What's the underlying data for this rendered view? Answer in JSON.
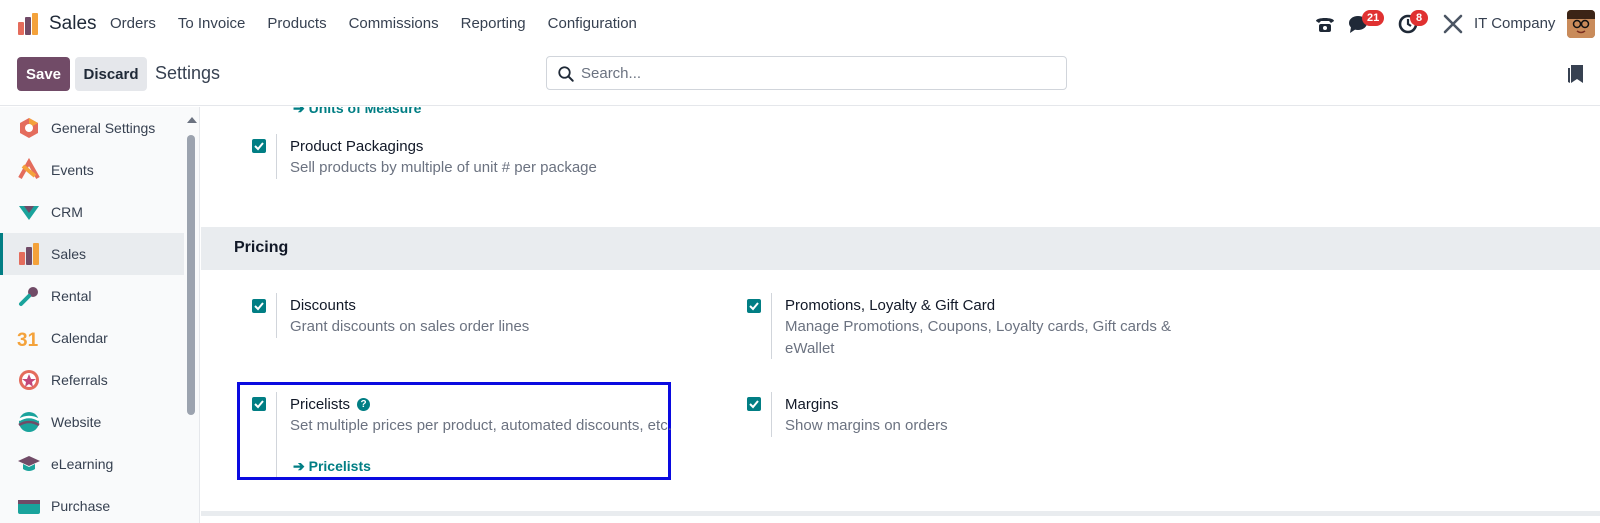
{
  "navbar": {
    "app_name": "Sales",
    "menu": [
      "Orders",
      "To Invoice",
      "Products",
      "Commissions",
      "Reporting",
      "Configuration"
    ],
    "messages_badge": "21",
    "activities_badge": "8",
    "company": "IT Company"
  },
  "control": {
    "save_label": "Save",
    "discard_label": "Discard",
    "breadcrumb": "Settings",
    "search_placeholder": "Search..."
  },
  "sidebar": {
    "items": [
      {
        "label": "General Settings",
        "icon": "general-settings-icon"
      },
      {
        "label": "Events",
        "icon": "events-icon"
      },
      {
        "label": "CRM",
        "icon": "crm-icon"
      },
      {
        "label": "Sales",
        "icon": "sales-icon",
        "active": true
      },
      {
        "label": "Rental",
        "icon": "rental-icon"
      },
      {
        "label": "Calendar",
        "icon": "calendar-icon"
      },
      {
        "label": "Referrals",
        "icon": "referrals-icon"
      },
      {
        "label": "Website",
        "icon": "website-icon"
      },
      {
        "label": "eLearning",
        "icon": "elearning-icon"
      },
      {
        "label": "Purchase",
        "icon": "purchase-icon"
      }
    ]
  },
  "main": {
    "uom_link": "Units of Measure",
    "product_packagings": {
      "title": "Product Packagings",
      "desc": "Sell products by multiple of unit # per package",
      "checked": true
    },
    "pricing_section": "Pricing",
    "discounts": {
      "title": "Discounts",
      "desc": "Grant discounts on sales order lines",
      "checked": true
    },
    "promotions": {
      "title": "Promotions, Loyalty & Gift Card",
      "desc_line1": "Manage Promotions, Coupons, Loyalty cards, Gift cards &",
      "desc_line2": "eWallet",
      "checked": true
    },
    "pricelists": {
      "title": "Pricelists",
      "desc": "Set multiple prices per product, automated discounts, etc.",
      "link": "Pricelists",
      "checked": true
    },
    "margins": {
      "title": "Margins",
      "desc": "Show margins on orders",
      "checked": true
    }
  },
  "colors": {
    "brand": "#714b67",
    "accent": "#017e84",
    "badge": "#e03131",
    "highlight": "#0a0ae0"
  }
}
